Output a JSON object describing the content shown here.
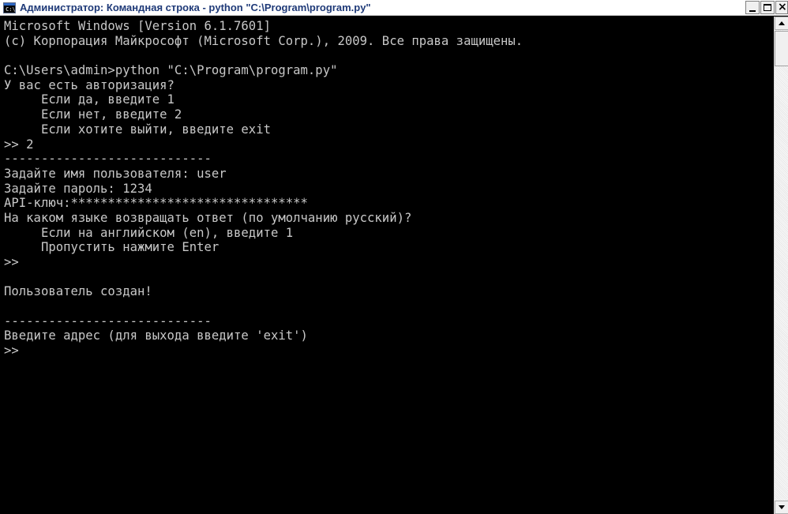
{
  "window": {
    "title": "Администратор: Командная строка - python  \"C:\\Program\\program.py\"",
    "icon_text": "C:\\"
  },
  "console": {
    "lines": [
      "Microsoft Windows [Version 6.1.7601]",
      "(c) Корпорация Майкрософт (Microsoft Corp.), 2009. Все права защищены.",
      "",
      "C:\\Users\\admin>python \"C:\\Program\\program.py\"",
      "У вас есть авторизация?",
      "     Если да, введите 1",
      "     Если нет, введите 2",
      "     Если хотите выйти, введите exit",
      ">> 2",
      "----------------------------",
      "Задайте имя пользователя: user",
      "Задайте пароль: 1234",
      "API-ключ:********************************",
      "На каком языке возвращать ответ (по умолчанию русский)?",
      "     Если на английском (en), введите 1",
      "     Пропустить нажмите Enter",
      ">>",
      "",
      "Пользователь создан!",
      "",
      "----------------------------",
      "Введите адрес (для выхода введите 'exit')",
      ">>"
    ]
  },
  "colors": {
    "console_bg": "#000000",
    "console_text": "#c8c8c8",
    "title_text": "#1f3a78"
  }
}
